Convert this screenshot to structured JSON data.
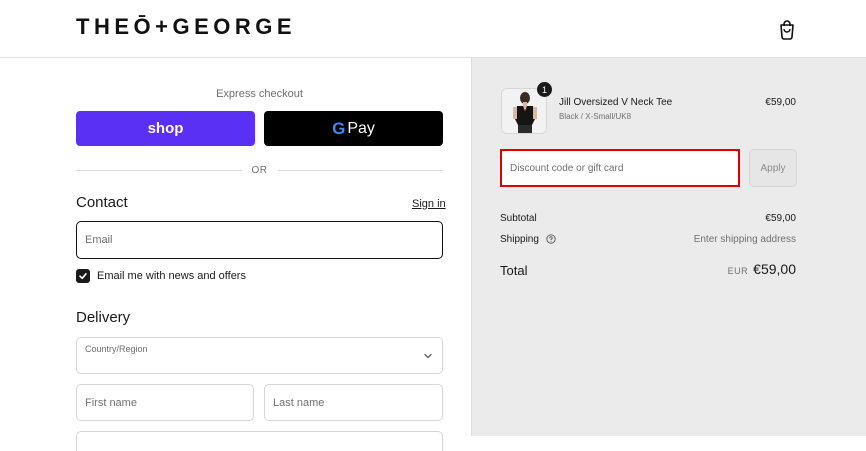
{
  "brand": {
    "logo_text": "THEŌ+GEORGE"
  },
  "express": {
    "label": "Express checkout",
    "shop_label": "shop",
    "gpay_g": "G",
    "gpay_label": "Pay",
    "or_text": "OR"
  },
  "contact": {
    "title": "Contact",
    "signin_label": "Sign in",
    "email_placeholder": "Email",
    "newsletter_label": "Email me with news and offers",
    "newsletter_checked": true
  },
  "delivery": {
    "title": "Delivery",
    "country_label": "Country/Region",
    "first_name_placeholder": "First name",
    "last_name_placeholder": "Last name"
  },
  "summary": {
    "item": {
      "name": "Jill Oversized V Neck Tee",
      "variant": "Black / X-Small/UK8",
      "price": "€59,00",
      "quantity": "1"
    },
    "discount_placeholder": "Discount code or gift card",
    "apply_label": "Apply",
    "subtotal_label": "Subtotal",
    "subtotal_value": "€59,00",
    "shipping_label": "Shipping",
    "shipping_value": "Enter shipping address",
    "total_label": "Total",
    "total_currency": "EUR",
    "total_value": "€59,00"
  },
  "colors": {
    "shop_purple": "#5a31f4",
    "gpay_black": "#000000",
    "highlight_red": "#e00000",
    "summary_bg": "#ebebeb"
  }
}
